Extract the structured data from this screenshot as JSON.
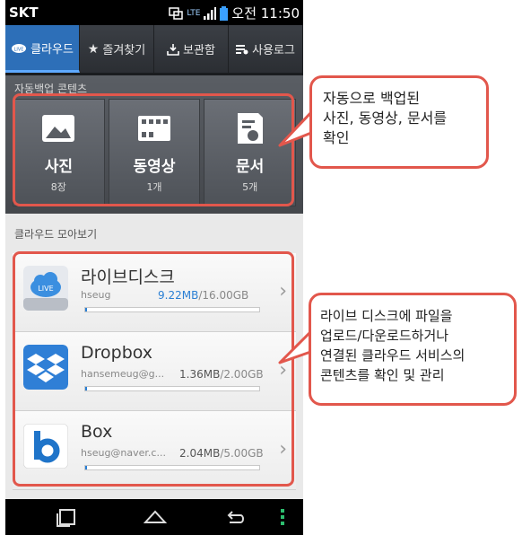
{
  "status_bar": {
    "carrier": "SKT",
    "network": "LTE",
    "time": "오전 11:50"
  },
  "tabs": [
    {
      "label": "클라우드",
      "icon": "live-icon",
      "active": true
    },
    {
      "label": "즐겨찾기",
      "icon": "star-icon",
      "active": false
    },
    {
      "label": "보관함",
      "icon": "download-tray-icon",
      "active": false
    },
    {
      "label": "사용로그",
      "icon": "log-list-icon",
      "active": false
    }
  ],
  "auto_backup": {
    "label": "자동백업 콘텐츠",
    "tiles": [
      {
        "name": "사진",
        "count": "8장",
        "icon": "photo-icon"
      },
      {
        "name": "동영상",
        "count": "1개",
        "icon": "film-icon"
      },
      {
        "name": "문서",
        "count": "5개",
        "icon": "document-icon"
      }
    ]
  },
  "cloud_overview": {
    "label": "클라우드 모아보기",
    "services": [
      {
        "title": "라이브디스크",
        "account": "hseug",
        "used": "9.22MB",
        "total": "/16.00GB",
        "progress": 0.006,
        "icon": "live-disk-icon"
      },
      {
        "title": "Dropbox",
        "account": "hansemeug@g...",
        "used": "1.36MB",
        "total": "/2.00GB",
        "progress": 0.007,
        "icon": "dropbox-icon"
      },
      {
        "title": "Box",
        "account": "hseug@naver.c...",
        "used": "2.04MB",
        "total": "/5.00GB",
        "progress": 0.004,
        "icon": "box-icon"
      }
    ]
  },
  "callouts": {
    "backup": [
      "자동으로 백업된",
      "사진, 동영상, 문서를",
      "확인"
    ],
    "cloud": [
      "라이브 디스크에 파일을",
      "업로드/다운로드하거나",
      "연결된 클라우드 서비스의",
      "콘텐츠를 확인 및 관리"
    ]
  },
  "colors": {
    "accent": "#2d6fb8",
    "highlight": "#e2574c"
  }
}
